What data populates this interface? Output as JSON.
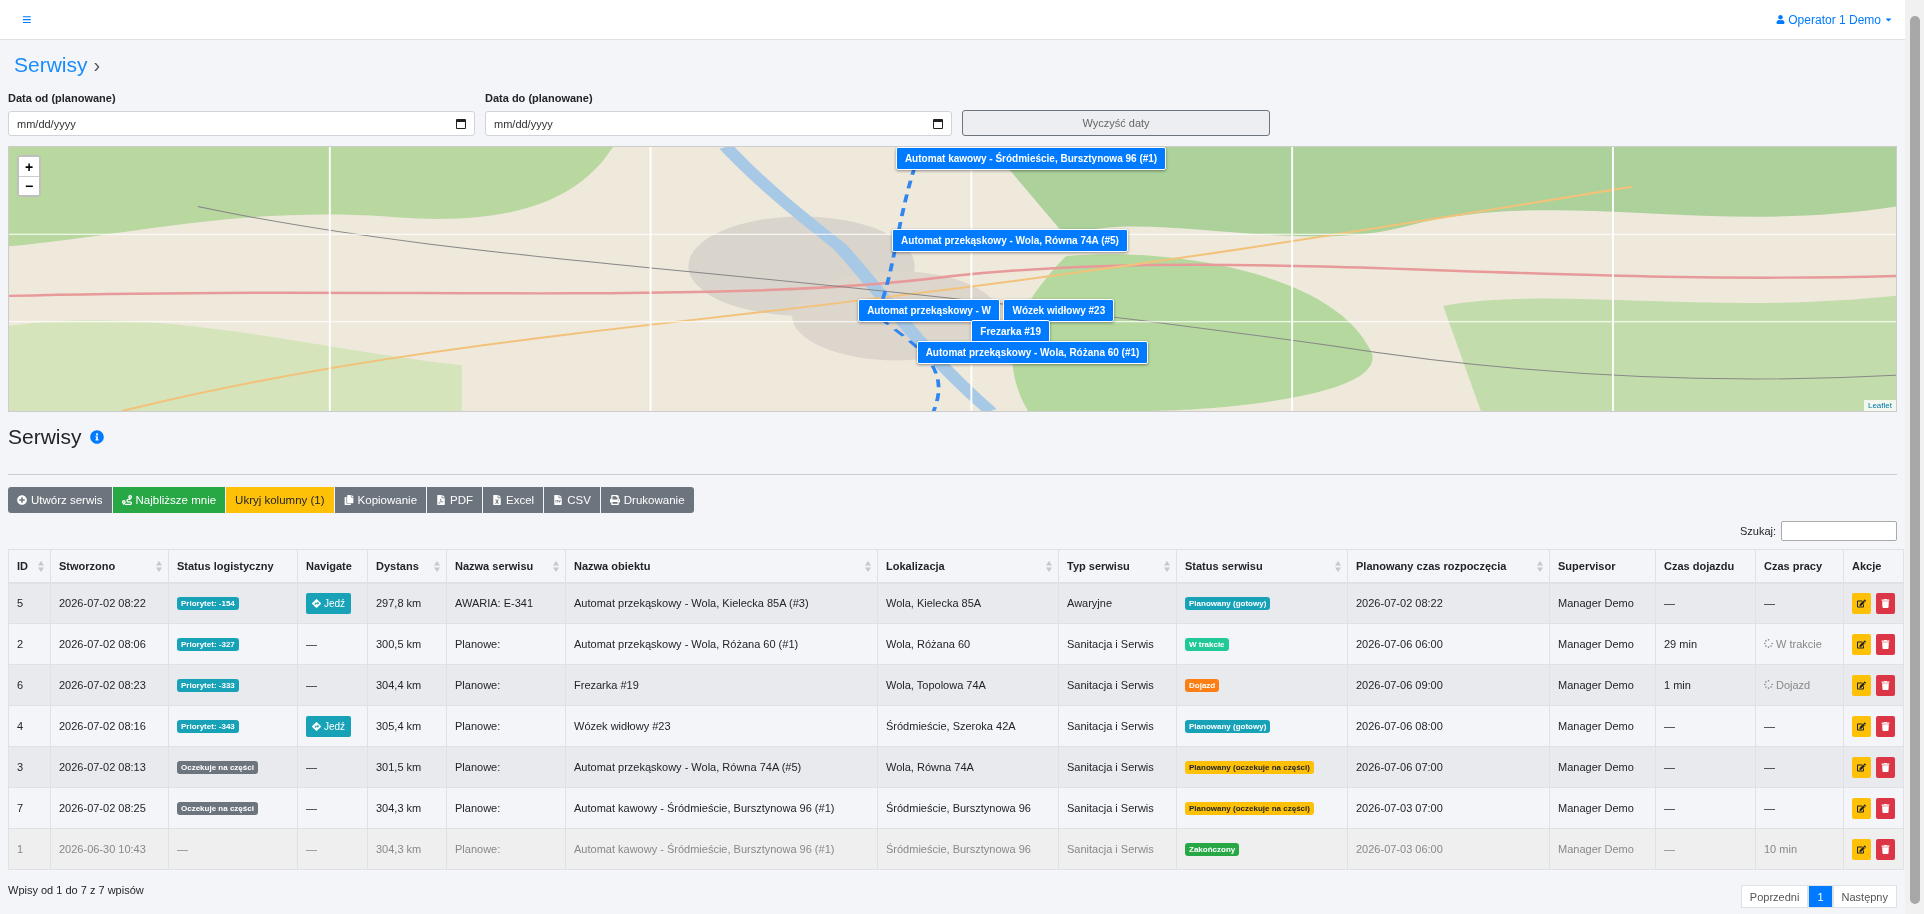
{
  "topbar": {
    "menu_icon": "≡",
    "user": "Operator 1 Demo"
  },
  "breadcrumb": {
    "title": "Serwisy",
    "chevron": "›"
  },
  "filters": [
    {
      "label": "Data od (planowane)",
      "placeholder": "mm/dd/yyyy"
    },
    {
      "label": "Data do (planowane)",
      "placeholder": "mm/dd/yyyy"
    }
  ],
  "clear_button": "Wyczyść daty",
  "map": {
    "zoom_in": "+",
    "zoom_out": "−",
    "attribution": "Leaflet",
    "popups": [
      {
        "label": "Automat kawowy - Śródmieście, Bursztynowa 96 (#1)"
      },
      {
        "label": "Automat przekąskowy - Wola, Równa 74A (#5)"
      },
      {
        "label": "Automat przekąskowy - W"
      },
      {
        "label": "Wózek widłowy #23"
      },
      {
        "label": "Frezarka #19"
      },
      {
        "label": "Automat przekąskowy - Wola, Różana 60 (#1)"
      }
    ]
  },
  "section": {
    "title": "Serwisy"
  },
  "toolbar": [
    {
      "label": "Utwórz serwis",
      "kind": "secondary"
    },
    {
      "label": "Najbliższe mnie",
      "kind": "success"
    },
    {
      "label": "Ukryj kolumny (1)",
      "kind": "warning"
    },
    {
      "label": "Kopiowanie",
      "kind": "secondary"
    },
    {
      "label": "PDF",
      "kind": "secondary"
    },
    {
      "label": "Excel",
      "kind": "secondary"
    },
    {
      "label": "CSV",
      "kind": "secondary"
    },
    {
      "label": "Drukowanie",
      "kind": "secondary"
    }
  ],
  "search": {
    "label": "Szukaj:"
  },
  "table": {
    "columns": [
      {
        "label": "ID",
        "sortable": true
      },
      {
        "label": "Stworzono",
        "sortable": true
      },
      {
        "label": "Status logistyczny",
        "sortable": false
      },
      {
        "label": "Navigate",
        "sortable": false
      },
      {
        "label": "Dystans",
        "sortable": true
      },
      {
        "label": "Nazwa serwisu",
        "sortable": true
      },
      {
        "label": "Nazwa obiektu",
        "sortable": true
      },
      {
        "label": "Lokalizacja",
        "sortable": true
      },
      {
        "label": "Typ serwisu",
        "sortable": true
      },
      {
        "label": "Status serwisu",
        "sortable": true
      },
      {
        "label": "Planowany czas rozpoczęcia",
        "sortable": true
      },
      {
        "label": "Supervisor",
        "sortable": false
      },
      {
        "label": "Czas dojazdu",
        "sortable": false
      },
      {
        "label": "Czas pracy",
        "sortable": false
      },
      {
        "label": "Akcje",
        "sortable": false
      }
    ],
    "rows": [
      {
        "muted": false,
        "id": "5",
        "created": "2026-07-02 08:22",
        "logistic": {
          "kind": "badge",
          "text": "Priorytet: -154",
          "color": "#17a2b8"
        },
        "navigate": {
          "kind": "button",
          "text": "Jedź"
        },
        "distance": "297,8 km",
        "service_name": "AWARIA: E-341",
        "object": "Automat przekąskowy - Wola, Kielecka 85A (#3)",
        "location": "Wola, Kielecka 85A",
        "type": "Awaryjne",
        "status": {
          "text": "Planowany (gotowy)",
          "color": "#17a2b8"
        },
        "planned": "2026-07-02 08:22",
        "supervisor": "Manager Demo",
        "travel": "—",
        "work": {
          "text": "—",
          "pending": false
        }
      },
      {
        "muted": false,
        "id": "2",
        "created": "2026-07-02 08:06",
        "logistic": {
          "kind": "badge",
          "text": "Priorytet: -327",
          "color": "#17a2b8"
        },
        "navigate": {
          "kind": "text",
          "text": "—"
        },
        "distance": "300,5 km",
        "service_name": "Planowe:",
        "object": "Automat przekąskowy - Wola, Różana 60 (#1)",
        "location": "Wola, Różana 60",
        "type": "Sanitacja i Serwis",
        "status": {
          "text": "W trakcie",
          "color": "#20c997"
        },
        "planned": "2026-07-06 06:00",
        "supervisor": "Manager Demo",
        "travel": "29 min",
        "work": {
          "text": "W trakcie",
          "pending": true
        }
      },
      {
        "muted": false,
        "id": "6",
        "created": "2026-07-02 08:23",
        "logistic": {
          "kind": "badge",
          "text": "Priorytet: -333",
          "color": "#17a2b8"
        },
        "navigate": {
          "kind": "text",
          "text": "—"
        },
        "distance": "304,4 km",
        "service_name": "Planowe:",
        "object": "Frezarka #19",
        "location": "Wola, Topolowa 74A",
        "type": "Sanitacja i Serwis",
        "status": {
          "text": "Dojazd",
          "color": "#fd7e14"
        },
        "planned": "2026-07-06 09:00",
        "supervisor": "Manager Demo",
        "travel": "1 min",
        "work": {
          "text": "Dojazd",
          "pending": true
        }
      },
      {
        "muted": false,
        "id": "4",
        "created": "2026-07-02 08:16",
        "logistic": {
          "kind": "badge",
          "text": "Priorytet: -343",
          "color": "#17a2b8"
        },
        "navigate": {
          "kind": "button",
          "text": "Jedź"
        },
        "distance": "305,4 km",
        "service_name": "Planowe:",
        "object": "Wózek widłowy #23",
        "location": "Śródmieście, Szeroka 42A",
        "type": "Sanitacja i Serwis",
        "status": {
          "text": "Planowany (gotowy)",
          "color": "#17a2b8"
        },
        "planned": "2026-07-06 08:00",
        "supervisor": "Manager Demo",
        "travel": "—",
        "work": {
          "text": "—",
          "pending": false
        }
      },
      {
        "muted": false,
        "id": "3",
        "created": "2026-07-02 08:13",
        "logistic": {
          "kind": "badge",
          "text": "Oczekuje na części",
          "color": "#6c757d"
        },
        "navigate": {
          "kind": "text",
          "text": "—"
        },
        "distance": "301,5 km",
        "service_name": "Planowe:",
        "object": "Automat przekąskowy - Wola, Równa 74A (#5)",
        "location": "Wola, Równa 74A",
        "type": "Sanitacja i Serwis",
        "status": {
          "text": "Planowany (oczekuje na części)",
          "color": "#ffc107"
        },
        "planned": "2026-07-06 07:00",
        "supervisor": "Manager Demo",
        "travel": "—",
        "work": {
          "text": "—",
          "pending": false
        }
      },
      {
        "muted": false,
        "id": "7",
        "created": "2026-07-02 08:25",
        "logistic": {
          "kind": "badge",
          "text": "Oczekuje na części",
          "color": "#6c757d"
        },
        "navigate": {
          "kind": "text",
          "text": "—"
        },
        "distance": "304,3 km",
        "service_name": "Planowe:",
        "object": "Automat kawowy - Śródmieście, Bursztynowa 96 (#1)",
        "location": "Śródmieście, Bursztynowa 96",
        "type": "Sanitacja i Serwis",
        "status": {
          "text": "Planowany (oczekuje na części)",
          "color": "#ffc107"
        },
        "planned": "2026-07-03 07:00",
        "supervisor": "Manager Demo",
        "travel": "—",
        "work": {
          "text": "—",
          "pending": false
        }
      },
      {
        "muted": true,
        "id": "1",
        "created": "2026-06-30 10:43",
        "logistic": {
          "kind": "text",
          "text": "—"
        },
        "navigate": {
          "kind": "text",
          "text": "—"
        },
        "distance": "304,3 km",
        "service_name": "Planowe:",
        "object": "Automat kawowy - Śródmieście, Bursztynowa 96 (#1)",
        "location": "Śródmieście, Bursztynowa 96",
        "type": "Sanitacja i Serwis",
        "status": {
          "text": "Zakończony",
          "color": "#28a745"
        },
        "planned": "2026-07-03 06:00",
        "supervisor": "Manager Demo",
        "travel": "—",
        "work": {
          "text": "10 min",
          "pending": false
        }
      }
    ]
  },
  "info": "Wpisy od 1 do 7 z 7 wpisów",
  "pagination": [
    {
      "label": "Poprzedni",
      "selected": false
    },
    {
      "label": "1",
      "selected": true
    },
    {
      "label": "Następny",
      "selected": false
    }
  ]
}
